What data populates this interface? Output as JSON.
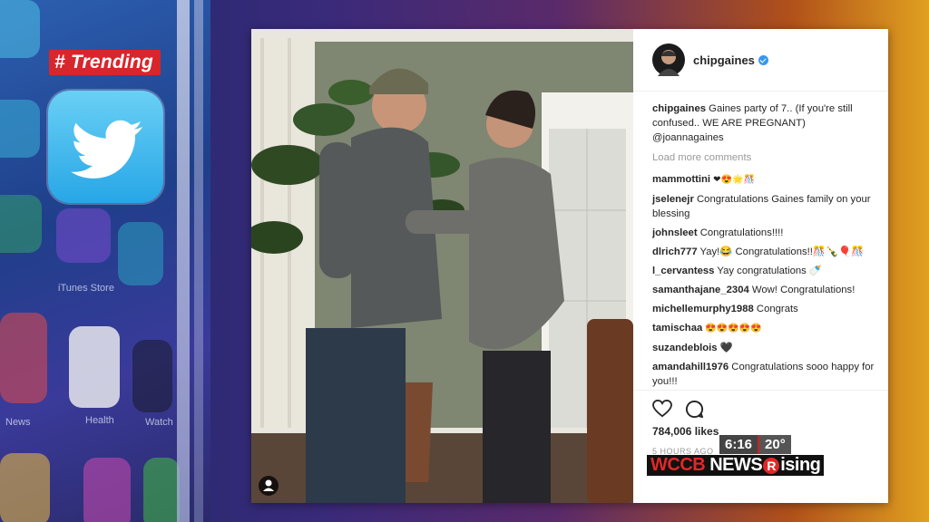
{
  "badge": {
    "trending_label": "# Trending"
  },
  "background_apps": {
    "labels": [
      "iTunes Store",
      "Health",
      "News",
      "Watch"
    ]
  },
  "post": {
    "username": "chipgaines",
    "caption_user": "chipgaines",
    "caption_text": "Gaines party of 7.. (If you're still confused.. WE ARE PREGNANT) @joannagaines",
    "load_more": "Load more comments",
    "comments": [
      {
        "user": "mammottini",
        "text": "❤😍🌟🎊"
      },
      {
        "user": "jselenejr",
        "text": "Congratulations Gaines family on your blessing"
      },
      {
        "user": "johnsleet",
        "text": "Congratulations!!!!"
      },
      {
        "user": "dlrich777",
        "text": "Yay!😂 Congratulations!!🎊🍾🎈🎊"
      },
      {
        "user": "l_cervantess",
        "text": "Yay congratulations 🍼"
      },
      {
        "user": "samanthajane_2304",
        "text": "Wow! Congratulations!"
      },
      {
        "user": "michellemurphy1988",
        "text": "Congrats"
      },
      {
        "user": "tamischaa",
        "text": "😍😍😍😍😍"
      },
      {
        "user": "suzandeblois",
        "text": "🖤"
      },
      {
        "user": "amandahill1976",
        "text": "Congratulations sooo happy for you!!!"
      }
    ],
    "likes": "784,006 likes",
    "time_ago": "5 HOURS AGO"
  },
  "broadcast": {
    "time": "6:16",
    "temperature": "20°",
    "station_a": "WCCB",
    "station_b": "NEWS",
    "station_r": "R",
    "station_c": "ising"
  },
  "colors": {
    "trending_red": "#d7262c",
    "twitter_blue": "#27a6e6",
    "verified_blue": "#3897f0",
    "news_red": "#e02828"
  }
}
